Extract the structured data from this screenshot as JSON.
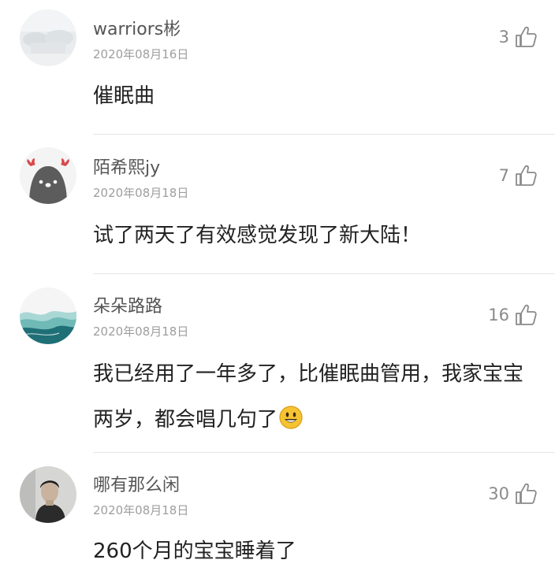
{
  "comments": [
    {
      "username": "warriors彬",
      "date": "2020年08月16日",
      "likes": "3",
      "text": "催眠曲",
      "avatar_icon": "avatar-landscape-icon"
    },
    {
      "username": "陌希熙jy",
      "date": "2020年08月18日",
      "likes": "7",
      "text": "试了两天了有效感觉发现了新大陆！",
      "avatar_icon": "avatar-cartoon-deer-icon"
    },
    {
      "username": "朵朵路路",
      "date": "2020年08月18日",
      "likes": "16",
      "text": "我已经用了一年多了，比催眠曲管用，我家宝宝两岁，都会唱几句了",
      "emoji": "smiley-emoji-icon",
      "avatar_icon": "avatar-wave-icon"
    },
    {
      "username": "哪有那么闲",
      "date": "2020年08月18日",
      "likes": "30",
      "text": "260个月的宝宝睡着了",
      "avatar_icon": "avatar-portrait-icon"
    }
  ],
  "colors": {
    "username": "#555555",
    "date": "#9e9e9e",
    "text": "#222222",
    "divider": "#e6e6e6",
    "like": "#8a8a8a"
  }
}
